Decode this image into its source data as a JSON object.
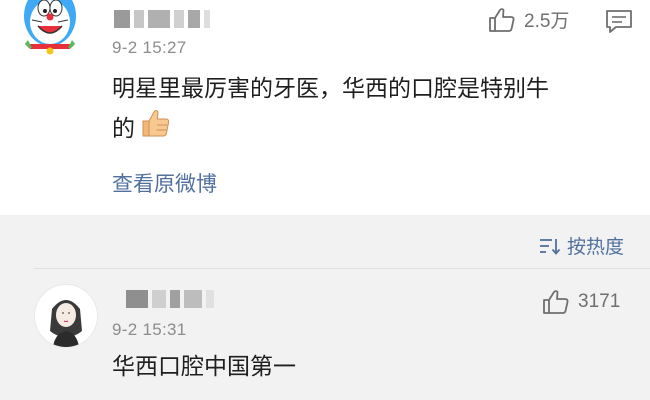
{
  "comment1": {
    "avatar": "doraemon-avatar",
    "timestamp": "9-2 15:27",
    "like_count": "2.5万",
    "text_line1": "明星里最厉害的牙医，华西的口腔是特别牛",
    "text_line2": "的",
    "emoji": "👍",
    "view_link": "查看原微博"
  },
  "sort": {
    "label": "按热度"
  },
  "comment2": {
    "avatar": "illustrated-girl-avatar",
    "timestamp": "9-2 15:31",
    "like_count": "3171",
    "text": "华西口腔中国第一"
  },
  "colors": {
    "link": "#51709e",
    "meta": "#8c8c8c",
    "panel": "#f2f2f2",
    "card": "#ffffff"
  }
}
